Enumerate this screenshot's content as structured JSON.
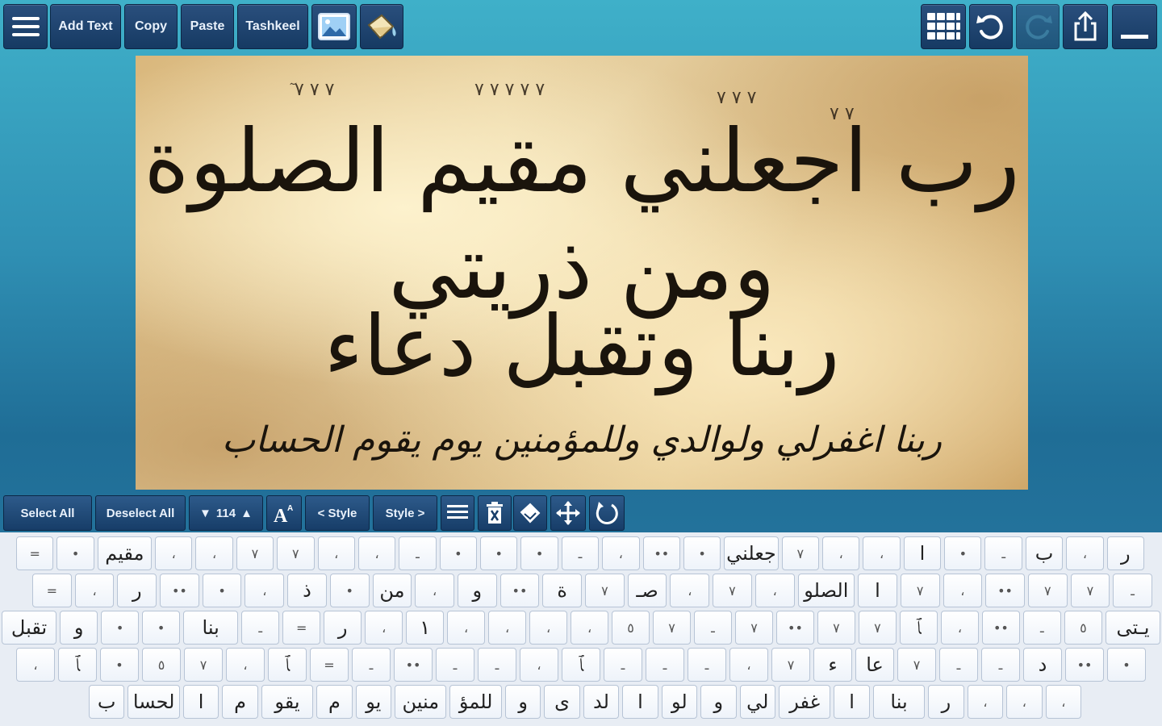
{
  "toolbar": {
    "menu_icon": "hamburger-menu-icon",
    "add_text": "Add Text",
    "copy": "Copy",
    "paste": "Paste",
    "tashkeel": "Tashkeel",
    "image_icon": "image-icon",
    "background_icon": "paint-bucket-icon",
    "grid_icon": "grid-icon",
    "undo_icon": "undo-icon",
    "redo_icon": "redo-icon",
    "share_icon": "share-icon",
    "minimize_icon": "minimize-icon"
  },
  "canvas": {
    "line1": "رب اجعلني مقيم الصلوة ومن ذريتي",
    "line2": "ربنا وتقبل دعاء",
    "line3": "ربنا اغفرلي ولوالدي وللمؤمنين يوم يقوم الحساب"
  },
  "edit_toolbar": {
    "select_all": "Select All",
    "deselect_all": "Deselect All",
    "font_size": "114",
    "prev_style": "< Style",
    "next_style": "Style >"
  },
  "keyboard": {
    "rows": [
      [
        "ر",
        "،",
        "ب",
        "ـ",
        "•",
        "ا",
        "،",
        "،",
        "٧",
        "جعلني",
        "•",
        "••",
        "،",
        "ـ",
        "•",
        "•",
        "•",
        "ـ",
        "،",
        "،",
        "٧",
        "٧",
        "،",
        "،",
        "مقيم",
        "•",
        "="
      ],
      [
        "ـ",
        "٧",
        "٧",
        "••",
        "،",
        "٧",
        "ا",
        "الصلو",
        "،",
        "٧",
        "،",
        "صـ",
        "٧",
        "ة",
        "••",
        "و",
        "،",
        "من",
        "•",
        "ذ",
        "،",
        "•",
        "••",
        "ر",
        "،",
        "="
      ],
      [
        "يـتى",
        "٥",
        "ـ",
        "••",
        "،",
        "ﭑ",
        "٧",
        "٧",
        "••",
        "٧",
        "ـ",
        "٧",
        "٥",
        "،",
        "،",
        "،",
        "،",
        "١",
        "،",
        "ر",
        "=",
        "ـ",
        "بنا",
        "•",
        "•",
        "و",
        "تقبل"
      ],
      [
        "•",
        "••",
        "د",
        "ـ",
        "ـ",
        "٧",
        "عا",
        "ء",
        "٧",
        "،",
        "ـ",
        "ـ",
        "ـ",
        "ﭑ",
        "،",
        "ـ",
        "ـ",
        "••",
        "ـ",
        "=",
        "ﭑ",
        "،",
        "٧",
        "٥",
        "•",
        "ﭑ",
        "،"
      ],
      [
        "،",
        "،",
        "،",
        "ر",
        "بنا",
        "ا",
        "غفر",
        "لي",
        "و",
        "لو",
        "ا",
        "لد",
        "ى",
        "و",
        "للمؤ",
        "منين",
        "يو",
        "م",
        "يقو",
        "م",
        "ا",
        "لحسا",
        "ب"
      ]
    ]
  }
}
